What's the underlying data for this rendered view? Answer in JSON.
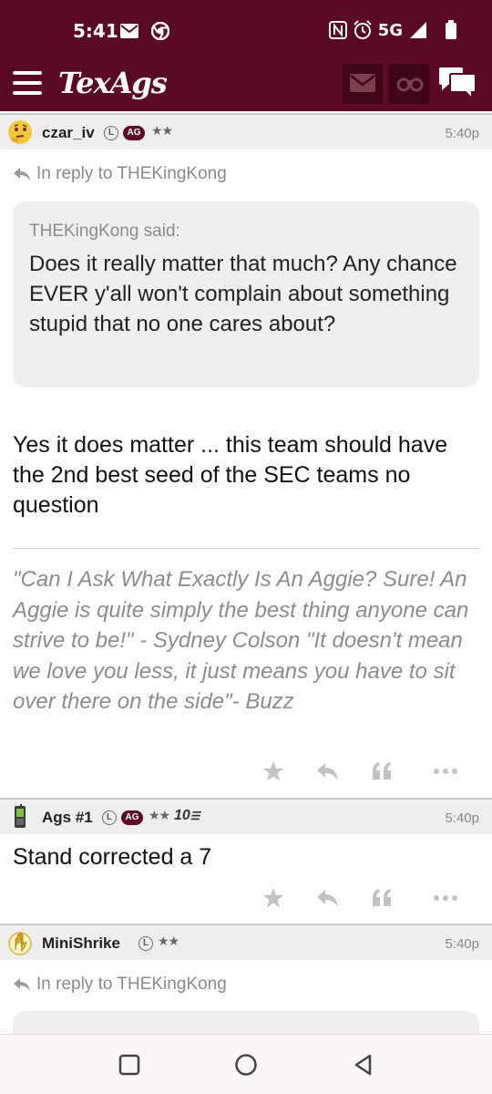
{
  "status_bar": {
    "time": "5:41",
    "network": "5G",
    "icons": [
      "mail-icon",
      "chrome-icon",
      "nfc-icon",
      "alarm-icon",
      "signal-icon",
      "battery-icon"
    ]
  },
  "app_bar": {
    "logo": "TexAgs",
    "icons": [
      "menu-icon",
      "mail-icon",
      "binoculars-icon",
      "chat-icon"
    ]
  },
  "posts": [
    {
      "username": "czar_iv",
      "badge_l": "L",
      "badge_ag": "AG",
      "stars": "★★",
      "time": "5:40p",
      "avatar_icon": "thinking-face-icon",
      "reply_to": "In reply to THEKingKong",
      "quote_said": "THEKingKong said:",
      "quote_text": "Does it really matter that much? Any chance EVER y'all won't complain about something stupid that no one cares about?",
      "body": "Yes it does matter ... this team should have the 2nd best seed of the SEC teams no question",
      "signature": "\"Can I Ask What Exactly Is An Aggie? Sure! An Aggie is quite simply the best thing anyone can strive to be!\" - Sydney Colson \"It doesn't mean we love you less, it just means you have to sit over there on the side\"- Buzz"
    },
    {
      "username": "Ags #1",
      "badge_l": "L",
      "badge_ag": "AG",
      "stars": "★★",
      "ten_year": "10",
      "time": "5:40p",
      "avatar_icon": "phone-icon",
      "body": "Stand corrected a 7"
    },
    {
      "username": "MiniShrike",
      "badge_l": "L",
      "stars": "★★",
      "time": "5:40p",
      "avatar_icon": "waving-hand-icon",
      "reply_to": "In reply to THEKingKong"
    }
  ],
  "colors": {
    "brand": "#5b0a24",
    "brand_dark": "#3e0517"
  }
}
